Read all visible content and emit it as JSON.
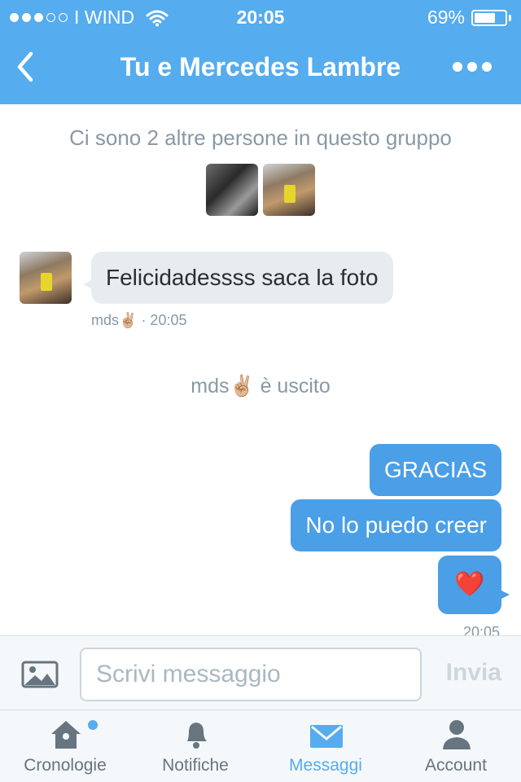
{
  "status_bar": {
    "carrier": "I WIND",
    "time": "20:05",
    "battery_percent": "69%",
    "battery_level": 0.69,
    "signal_bars_filled": 3,
    "signal_bars_total": 5
  },
  "nav": {
    "title": "Tu e Mercedes Lambre",
    "back_icon": "chevron-left-icon",
    "more_icon": "more-dots-icon"
  },
  "chat": {
    "group_info": "Ci sono 2 altre persone in questo gruppo",
    "messages_in": [
      {
        "text": "Felicidadessss saca la foto",
        "sender": "mds✌🏼",
        "time": "· 20:05"
      }
    ],
    "event": "mds✌🏼 è uscito",
    "messages_out": [
      {
        "text": "GRACIAS"
      },
      {
        "text": "No lo puedo creer"
      },
      {
        "text": "❤️"
      }
    ],
    "last_time": "20:05"
  },
  "composer": {
    "placeholder": "Scrivi messaggio",
    "send_label": "Invia"
  },
  "tabs": [
    {
      "label": "Cronologie",
      "icon": "home-icon",
      "active": false,
      "badge": true
    },
    {
      "label": "Notifiche",
      "icon": "bell-icon",
      "active": false,
      "badge": false
    },
    {
      "label": "Messaggi",
      "icon": "envelope-icon",
      "active": true,
      "badge": false
    },
    {
      "label": "Account",
      "icon": "person-icon",
      "active": false,
      "badge": false
    }
  ],
  "colors": {
    "accent": "#55acee",
    "bubble_out": "#4a9fe6",
    "bubble_in": "#e6ecf0",
    "muted_text": "#8899a6"
  }
}
